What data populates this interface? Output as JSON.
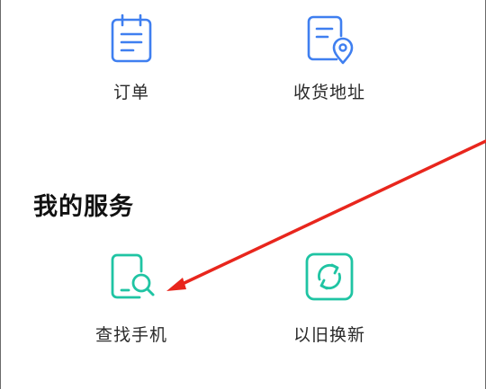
{
  "top_row": {
    "orders": {
      "label": "订单",
      "icon": "order-clipboard-icon"
    },
    "address": {
      "label": "收货地址",
      "icon": "delivery-address-icon"
    }
  },
  "services": {
    "title": "我的服务",
    "items": [
      {
        "label": "查找手机",
        "icon": "find-phone-icon"
      },
      {
        "label": "以旧换新",
        "icon": "trade-in-refresh-icon"
      }
    ]
  },
  "colors": {
    "blue_icon": "#3f7ff0",
    "teal_icon": "#1fc4a3",
    "annotation_arrow": "#e8261d"
  }
}
